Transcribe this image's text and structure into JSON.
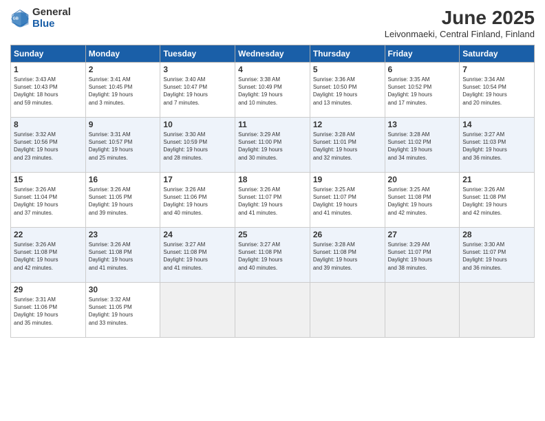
{
  "header": {
    "logo_general": "General",
    "logo_blue": "Blue",
    "month_title": "June 2025",
    "location": "Leivonmaeki, Central Finland, Finland"
  },
  "days_of_week": [
    "Sunday",
    "Monday",
    "Tuesday",
    "Wednesday",
    "Thursday",
    "Friday",
    "Saturday"
  ],
  "weeks": [
    [
      {
        "day": "1",
        "info": "Sunrise: 3:43 AM\nSunset: 10:43 PM\nDaylight: 18 hours\nand 59 minutes."
      },
      {
        "day": "2",
        "info": "Sunrise: 3:41 AM\nSunset: 10:45 PM\nDaylight: 19 hours\nand 3 minutes."
      },
      {
        "day": "3",
        "info": "Sunrise: 3:40 AM\nSunset: 10:47 PM\nDaylight: 19 hours\nand 7 minutes."
      },
      {
        "day": "4",
        "info": "Sunrise: 3:38 AM\nSunset: 10:49 PM\nDaylight: 19 hours\nand 10 minutes."
      },
      {
        "day": "5",
        "info": "Sunrise: 3:36 AM\nSunset: 10:50 PM\nDaylight: 19 hours\nand 13 minutes."
      },
      {
        "day": "6",
        "info": "Sunrise: 3:35 AM\nSunset: 10:52 PM\nDaylight: 19 hours\nand 17 minutes."
      },
      {
        "day": "7",
        "info": "Sunrise: 3:34 AM\nSunset: 10:54 PM\nDaylight: 19 hours\nand 20 minutes."
      }
    ],
    [
      {
        "day": "8",
        "info": "Sunrise: 3:32 AM\nSunset: 10:56 PM\nDaylight: 19 hours\nand 23 minutes."
      },
      {
        "day": "9",
        "info": "Sunrise: 3:31 AM\nSunset: 10:57 PM\nDaylight: 19 hours\nand 25 minutes."
      },
      {
        "day": "10",
        "info": "Sunrise: 3:30 AM\nSunset: 10:59 PM\nDaylight: 19 hours\nand 28 minutes."
      },
      {
        "day": "11",
        "info": "Sunrise: 3:29 AM\nSunset: 11:00 PM\nDaylight: 19 hours\nand 30 minutes."
      },
      {
        "day": "12",
        "info": "Sunrise: 3:28 AM\nSunset: 11:01 PM\nDaylight: 19 hours\nand 32 minutes."
      },
      {
        "day": "13",
        "info": "Sunrise: 3:28 AM\nSunset: 11:02 PM\nDaylight: 19 hours\nand 34 minutes."
      },
      {
        "day": "14",
        "info": "Sunrise: 3:27 AM\nSunset: 11:03 PM\nDaylight: 19 hours\nand 36 minutes."
      }
    ],
    [
      {
        "day": "15",
        "info": "Sunrise: 3:26 AM\nSunset: 11:04 PM\nDaylight: 19 hours\nand 37 minutes."
      },
      {
        "day": "16",
        "info": "Sunrise: 3:26 AM\nSunset: 11:05 PM\nDaylight: 19 hours\nand 39 minutes."
      },
      {
        "day": "17",
        "info": "Sunrise: 3:26 AM\nSunset: 11:06 PM\nDaylight: 19 hours\nand 40 minutes."
      },
      {
        "day": "18",
        "info": "Sunrise: 3:26 AM\nSunset: 11:07 PM\nDaylight: 19 hours\nand 41 minutes."
      },
      {
        "day": "19",
        "info": "Sunrise: 3:25 AM\nSunset: 11:07 PM\nDaylight: 19 hours\nand 41 minutes."
      },
      {
        "day": "20",
        "info": "Sunrise: 3:25 AM\nSunset: 11:08 PM\nDaylight: 19 hours\nand 42 minutes."
      },
      {
        "day": "21",
        "info": "Sunrise: 3:26 AM\nSunset: 11:08 PM\nDaylight: 19 hours\nand 42 minutes."
      }
    ],
    [
      {
        "day": "22",
        "info": "Sunrise: 3:26 AM\nSunset: 11:08 PM\nDaylight: 19 hours\nand 42 minutes."
      },
      {
        "day": "23",
        "info": "Sunrise: 3:26 AM\nSunset: 11:08 PM\nDaylight: 19 hours\nand 41 minutes."
      },
      {
        "day": "24",
        "info": "Sunrise: 3:27 AM\nSunset: 11:08 PM\nDaylight: 19 hours\nand 41 minutes."
      },
      {
        "day": "25",
        "info": "Sunrise: 3:27 AM\nSunset: 11:08 PM\nDaylight: 19 hours\nand 40 minutes."
      },
      {
        "day": "26",
        "info": "Sunrise: 3:28 AM\nSunset: 11:08 PM\nDaylight: 19 hours\nand 39 minutes."
      },
      {
        "day": "27",
        "info": "Sunrise: 3:29 AM\nSunset: 11:07 PM\nDaylight: 19 hours\nand 38 minutes."
      },
      {
        "day": "28",
        "info": "Sunrise: 3:30 AM\nSunset: 11:07 PM\nDaylight: 19 hours\nand 36 minutes."
      }
    ],
    [
      {
        "day": "29",
        "info": "Sunrise: 3:31 AM\nSunset: 11:06 PM\nDaylight: 19 hours\nand 35 minutes."
      },
      {
        "day": "30",
        "info": "Sunrise: 3:32 AM\nSunset: 11:05 PM\nDaylight: 19 hours\nand 33 minutes."
      },
      {
        "day": "",
        "info": ""
      },
      {
        "day": "",
        "info": ""
      },
      {
        "day": "",
        "info": ""
      },
      {
        "day": "",
        "info": ""
      },
      {
        "day": "",
        "info": ""
      }
    ]
  ]
}
